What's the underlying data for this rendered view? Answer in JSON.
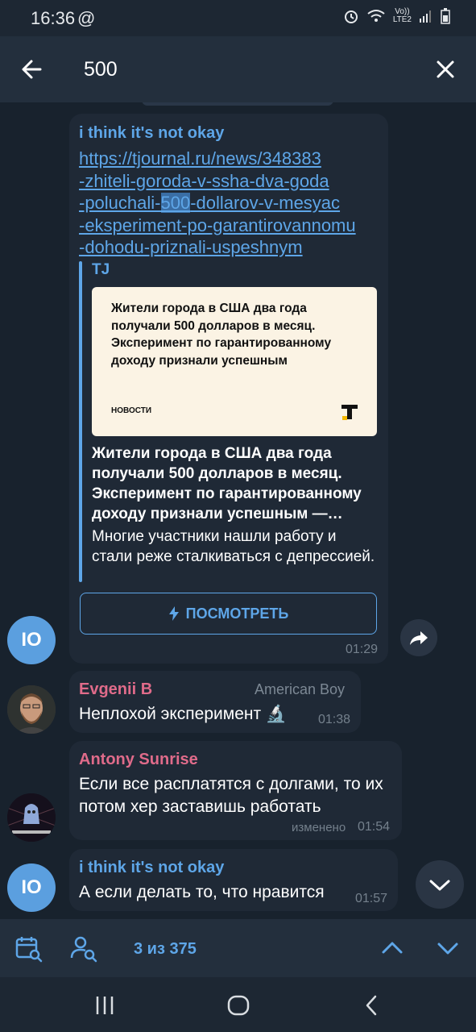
{
  "status_bar": {
    "time": "16:36",
    "at_symbol": "@",
    "network_label_top": "Vo))",
    "network_label_bottom": "LTE2",
    "icons": [
      "alarm-icon",
      "wifi-icon",
      "signal-icon",
      "battery-icon"
    ]
  },
  "header": {
    "search_query": "500",
    "back_icon": "arrow-left-icon",
    "close_icon": "close-icon"
  },
  "messages": [
    {
      "sender": "i think it's not okay",
      "sender_color": "#5ea6e8",
      "avatar_initials": "IO",
      "link_lines": [
        "https://tjournal.ru/news/348383",
        "-zhiteli-goroda-v-ssha-dva-goda",
        "-poluchali-",
        "500",
        "-dollarov-v-mesyac",
        "-eksperiment-po-garantirovannomu",
        "-dohodu-priznali-uspeshnym"
      ],
      "preview": {
        "site": "TJ",
        "image_title": "Жители города в США два года получали 500 долларов в месяц. Эксперимент по гарантированному доходу признали успешным",
        "image_tag": "НОВОСТИ",
        "title": "Жители города в США два года получали 500 долларов в месяц. Эксперимент по гарантированному доходу признали успешным —…",
        "description": "Многие участники нашли работу и стали реже сталкиваться с депрессией.",
        "button_label": "ПОСМОТРЕТЬ"
      },
      "time": "01:29"
    },
    {
      "sender": "Evgenii B",
      "sender_color": "#e06b8a",
      "admin_title": "American Boy",
      "text": "Неплохой эксперимент 🔬",
      "time": "01:38"
    },
    {
      "sender": "Antony Sunrise",
      "sender_color": "#e06b8a",
      "text": "Если все расплатятся с долгами, то их потом хер заставишь работать",
      "edited_label": "изменено",
      "time": "01:54"
    },
    {
      "sender": "i think it's not okay",
      "sender_color": "#5ea6e8",
      "avatar_initials": "IO",
      "text": "А если делать то, что нравится",
      "time": "01:57"
    }
  ],
  "search_nav": {
    "counter": "3 из 375",
    "icons": [
      "calendar-search-icon",
      "user-search-icon",
      "chevron-up-icon",
      "chevron-down-icon"
    ]
  },
  "system_nav": {
    "icons": [
      "recents-icon",
      "home-icon",
      "back-icon"
    ]
  },
  "colors": {
    "accent": "#5ea6e8",
    "bubble": "#1f2936",
    "background": "#18222d",
    "header": "#232f3d"
  }
}
